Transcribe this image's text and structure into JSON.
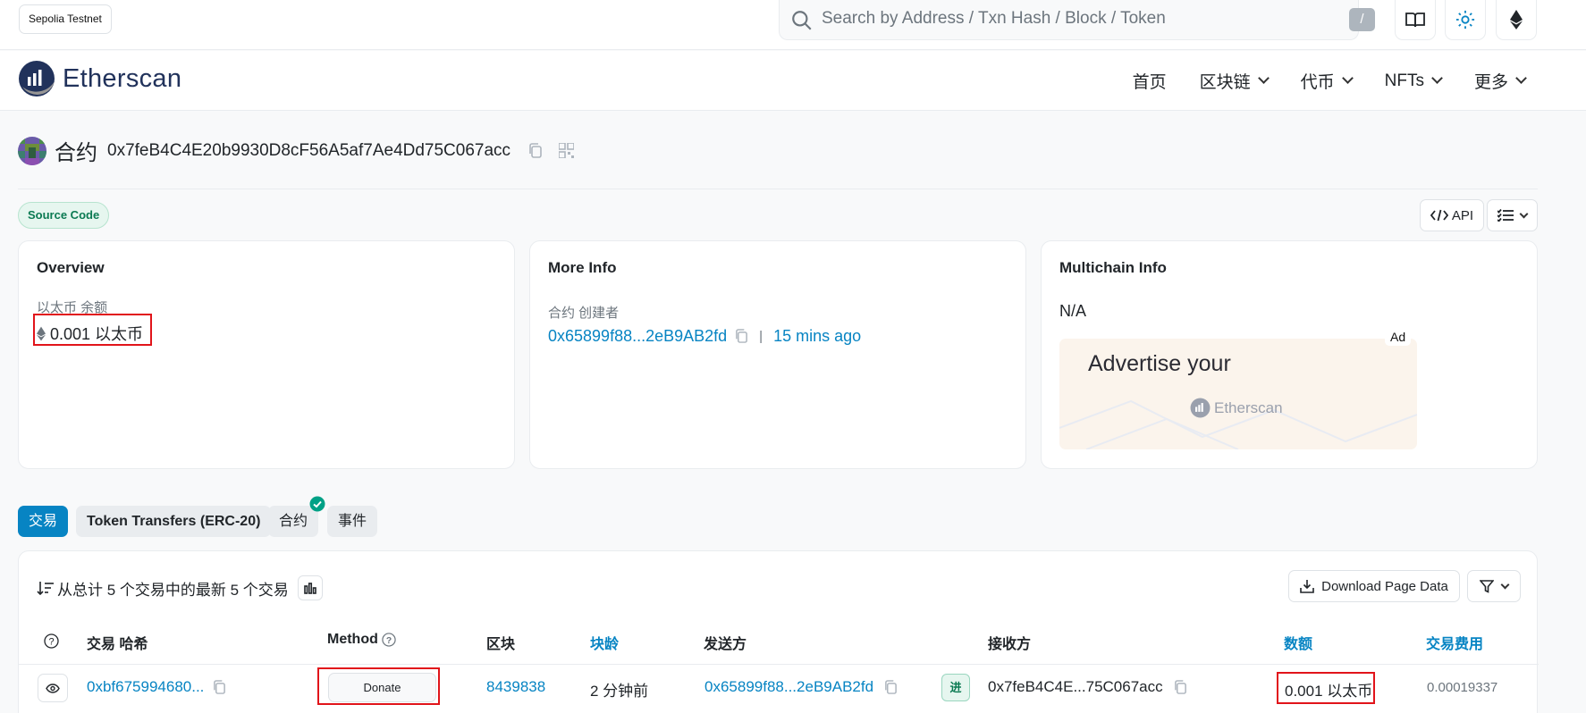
{
  "topbar": {
    "network": "Sepolia Testnet",
    "search_placeholder": "Search by Address / Txn Hash / Block / Token",
    "search_shortcut": "/"
  },
  "nav": {
    "logo": "Etherscan",
    "items": [
      "首页",
      "区块链",
      "代币",
      "NFTs",
      "更多"
    ]
  },
  "header": {
    "type": "合约",
    "address": "0x7feB4C4E20b9930D8cF56A5af7Ae4Dd75C067acc"
  },
  "badges": {
    "source_code": "Source Code",
    "api": "API"
  },
  "overview": {
    "title": "Overview",
    "balance_label": "以太币 余额",
    "balance_value": "0.001 以太币"
  },
  "more_info": {
    "title": "More Info",
    "creator_label": "合约 创建者",
    "creator_address": "0x65899f88...2eB9AB2fd",
    "separator": "|",
    "created_ago": "15 mins ago"
  },
  "multichain": {
    "title": "Multichain Info",
    "value": "N/A",
    "ad_text": "Advertise your",
    "ad_brand": "Etherscan",
    "ad_label": "Ad"
  },
  "tabs": [
    "交易",
    "Token Transfers (ERC-20)",
    "合约",
    "事件"
  ],
  "transactions": {
    "summary": "从总计 5 个交易中的最新 5 个交易",
    "download_label": "Download Page Data",
    "columns": [
      "交易 哈希",
      "Method",
      "区块",
      "块龄",
      "发送方",
      "接收方",
      "数额",
      "交易费用"
    ],
    "rows": [
      {
        "hash": "0xbf675994680...",
        "method": "Donate",
        "block": "8439838",
        "age": "2 分钟前",
        "from": "0x65899f88...2eB9AB2fd",
        "direction": "进",
        "to": "0x7feB4C4E...75C067acc",
        "amount": "0.001 以太币",
        "fee": "0.00019337"
      }
    ]
  },
  "colors": {
    "accent": "#0784c3",
    "highlight": "#e1141a",
    "success": "#0b7a52"
  }
}
